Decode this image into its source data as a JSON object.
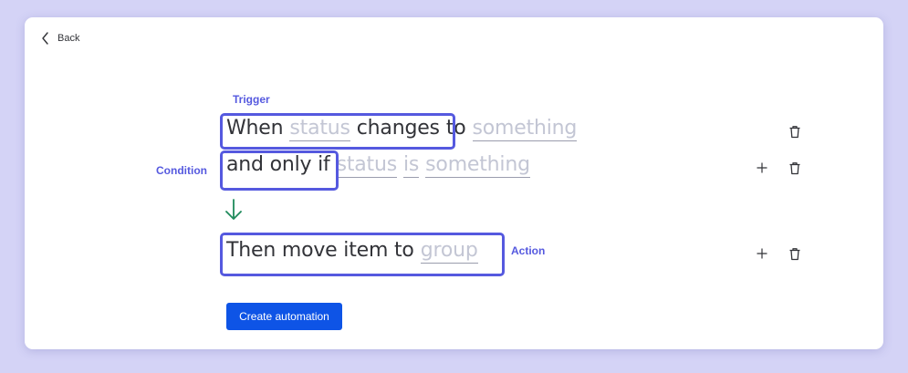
{
  "nav": {
    "back_label": "Back"
  },
  "annotations": {
    "trigger": "Trigger",
    "condition": "Condition",
    "action": "Action"
  },
  "rules": {
    "trigger": {
      "prefix": "When",
      "field": "status",
      "verb": "changes",
      "connector": "to",
      "value": "something"
    },
    "condition": {
      "prefix": "and only if",
      "field": "status",
      "operator": "is",
      "value": "something"
    },
    "action": {
      "text": "Then move item to",
      "target": "group"
    }
  },
  "buttons": {
    "create_label": "Create automation"
  },
  "colors": {
    "accent": "#5559df",
    "primary_button": "#0e54e6",
    "arrow": "#1f8a5b",
    "placeholder": "#c3c6d4",
    "background": "#d4d3f6"
  }
}
